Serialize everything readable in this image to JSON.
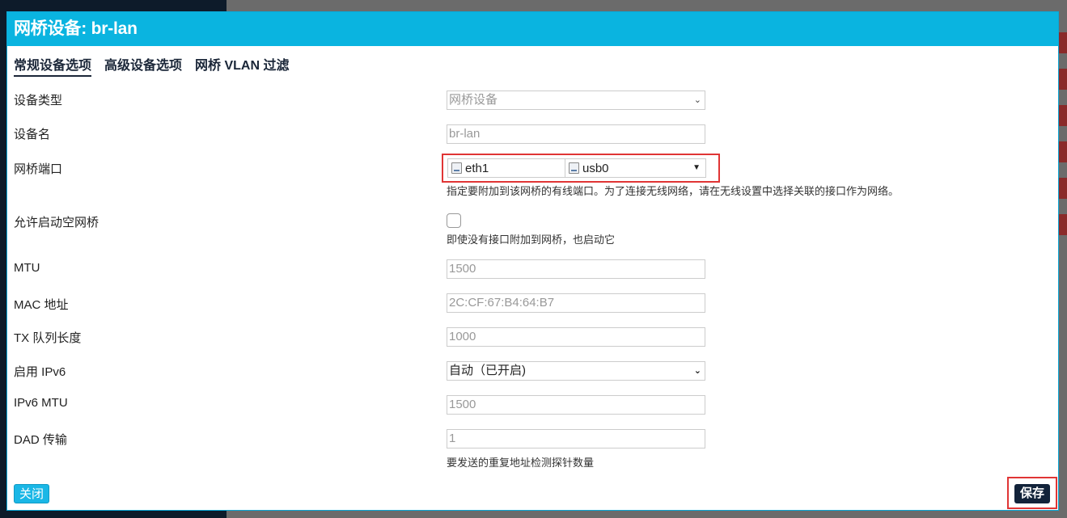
{
  "modal": {
    "title": "网桥设备: br-lan"
  },
  "tabs": [
    {
      "label": "常规设备选项",
      "active": true
    },
    {
      "label": "高级设备选项",
      "active": false
    },
    {
      "label": "网桥 VLAN 过滤",
      "active": false
    }
  ],
  "fields": {
    "device_type": {
      "label": "设备类型",
      "value": "网桥设备"
    },
    "device_name": {
      "label": "设备名",
      "value": "br-lan"
    },
    "bridge_ports": {
      "label": "网桥端口",
      "ports": [
        "eth1",
        "usb0"
      ],
      "description": "指定要附加到该网桥的有线端口。为了连接无线网络，请在无线设置中选择关联的接口作为网络。"
    },
    "allow_empty_bridge": {
      "label": "允许启动空网桥",
      "checked": false,
      "description": "即使没有接口附加到网桥，也启动它"
    },
    "mtu": {
      "label": "MTU",
      "placeholder": "1500"
    },
    "mac": {
      "label": "MAC 地址",
      "placeholder": "2C:CF:67:B4:64:B7"
    },
    "txqueuelen": {
      "label": "TX 队列长度",
      "placeholder": "1000"
    },
    "ipv6": {
      "label": "启用 IPv6",
      "value": "自动（已开启)"
    },
    "ipv6_mtu": {
      "label": "IPv6 MTU",
      "placeholder": "1500"
    },
    "dad": {
      "label": "DAD 传输",
      "placeholder": "1",
      "description": "要发送的重复地址检测探针数量"
    }
  },
  "buttons": {
    "close": "关闭",
    "save": "保存"
  },
  "colors": {
    "header": "#0ab4e0",
    "save_button": "#12233a",
    "highlight": "#e03535"
  }
}
